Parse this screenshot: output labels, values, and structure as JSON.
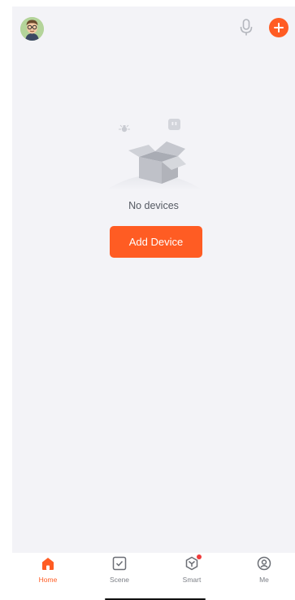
{
  "main": {
    "empty_state": {
      "message": "No devices"
    },
    "add_device_label": "Add Device"
  },
  "tab_bar": {
    "tabs": [
      {
        "label": "Home",
        "icon": "home-icon",
        "active": true
      },
      {
        "label": "Scene",
        "icon": "scene-icon",
        "active": false
      },
      {
        "label": "Smart",
        "icon": "smart-icon",
        "active": false,
        "badge": true
      },
      {
        "label": "Me",
        "icon": "profile-icon",
        "active": false
      }
    ]
  },
  "colors": {
    "accent": "#ff5c23",
    "background": "#f3f3f7",
    "badge": "#ef3b3b",
    "inactive_text": "#7c7f86"
  }
}
